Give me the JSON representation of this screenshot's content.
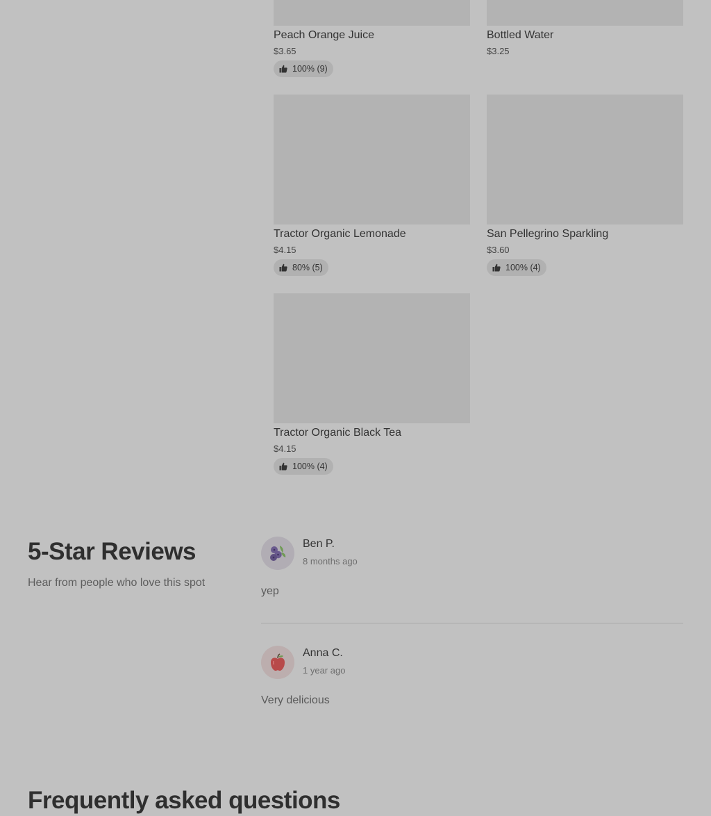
{
  "products": [
    {
      "name": "Peach Orange Juice",
      "price": "$3.65",
      "rating": "100% (9)"
    },
    {
      "name": "Bottled Water",
      "price": "$3.25",
      "rating": ""
    },
    {
      "name": "Tractor Organic Lemonade",
      "price": "$4.15",
      "rating": "80% (5)"
    },
    {
      "name": "San Pellegrino Sparkling",
      "price": "$3.60",
      "rating": "100% (4)"
    },
    {
      "name": "Tractor Organic Black Tea",
      "price": "$4.15",
      "rating": "100% (4)"
    }
  ],
  "reviews": {
    "title": "5-Star Reviews",
    "subtitle": "Hear from people who love this spot",
    "items": [
      {
        "name": "Ben P.",
        "date": "8 months ago",
        "text": "yep",
        "avatar_icon": "blueberries-icon"
      },
      {
        "name": "Anna C.",
        "date": "1 year ago",
        "text": "Very delicious",
        "avatar_icon": "apple-icon"
      }
    ]
  },
  "faq": {
    "title": "Frequently asked questions"
  },
  "colors": {
    "overlay_background": "#c1c1c1",
    "image_placeholder": "#b3b3b3",
    "badge_background": "#b1b1b1",
    "heading_text": "#2f2f2f"
  }
}
